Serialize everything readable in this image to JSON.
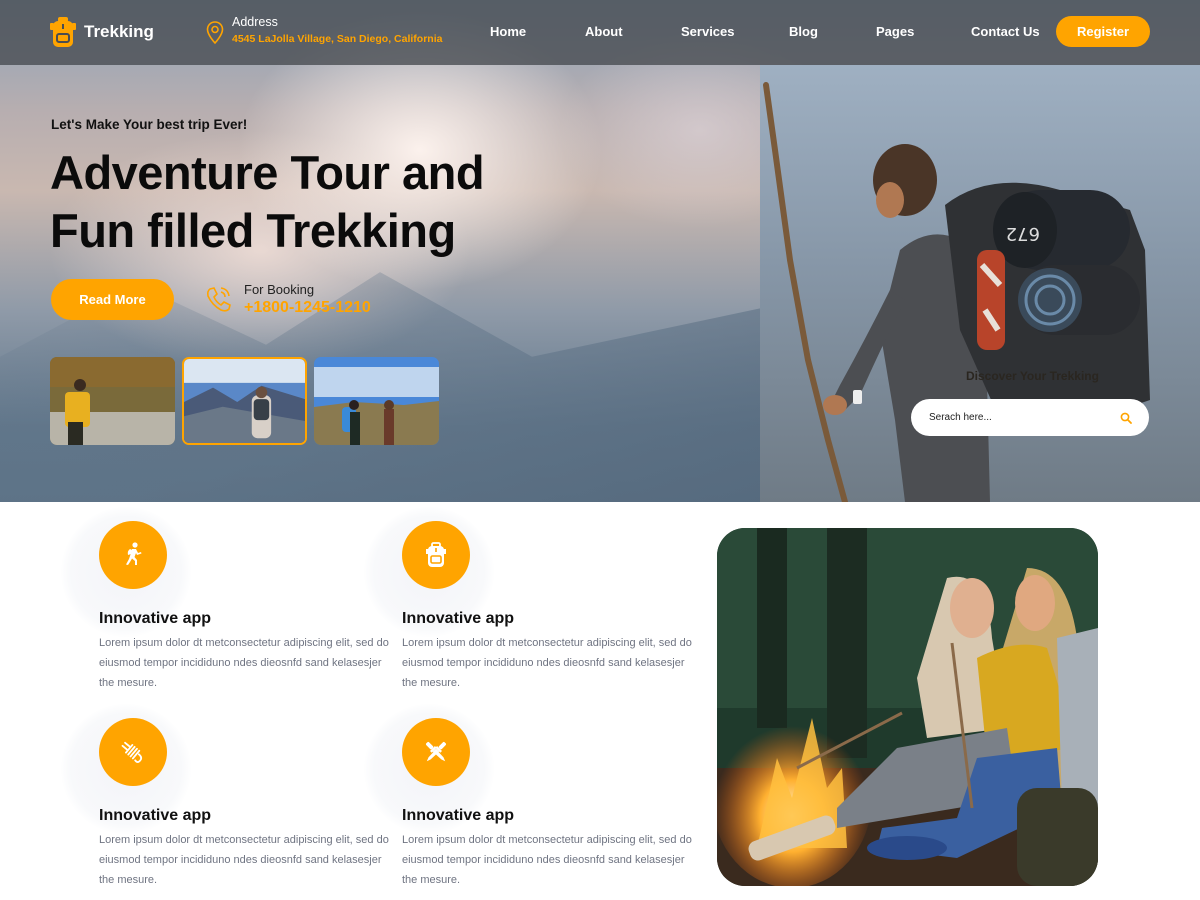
{
  "brand": {
    "name": "Trekking",
    "accent_color": "#ffa400"
  },
  "header": {
    "address_label": "Address",
    "address_value": "4545 LaJolla Village, San Diego, California",
    "nav": [
      "Home",
      "About",
      "Services",
      "Blog",
      "Pages",
      "Contact Us"
    ],
    "register_label": "Register"
  },
  "hero": {
    "tagline": "Let's Make Your best trip Ever!",
    "headline_line1": "Adventure Tour and",
    "headline_line2": "Fun filled Trekking",
    "read_more_label": "Read More",
    "booking_label": "For Booking",
    "booking_phone": "+1800-1245-1210",
    "thumbnails": [
      {
        "name": "hiker-yellow-pack-lake",
        "active": false
      },
      {
        "name": "hiker-mountain-view",
        "active": true
      },
      {
        "name": "two-hikers-meadow",
        "active": false
      }
    ],
    "discover_label": "Discover Your Trekking",
    "search_placeholder": "Serach here..."
  },
  "features": [
    {
      "icon": "hiking-person-icon",
      "title": "Innovative app",
      "text": "Lorem ipsum dolor dt metconsectetur adipiscing elit, sed do eiusmod tempor incididuno ndes dieosnfd sand kelasesjer the mesure."
    },
    {
      "icon": "backpack-icon",
      "title": "Innovative app",
      "text": "Lorem ipsum dolor dt metconsectetur adipiscing elit, sed do eiusmod tempor incididuno ndes dieosnfd sand kelasesjer the mesure."
    },
    {
      "icon": "rope-icon",
      "title": "Innovative app",
      "text": "Lorem ipsum dolor dt metconsectetur adipiscing elit, sed do eiusmod tempor incididuno ndes dieosnfd sand kelasesjer the mesure."
    },
    {
      "icon": "crossed-tools-icon",
      "title": "Innovative app",
      "text": "Lorem ipsum dolor dt metconsectetur adipiscing elit, sed do eiusmod tempor incididuno ndes dieosnfd sand kelasesjer the mesure."
    }
  ]
}
